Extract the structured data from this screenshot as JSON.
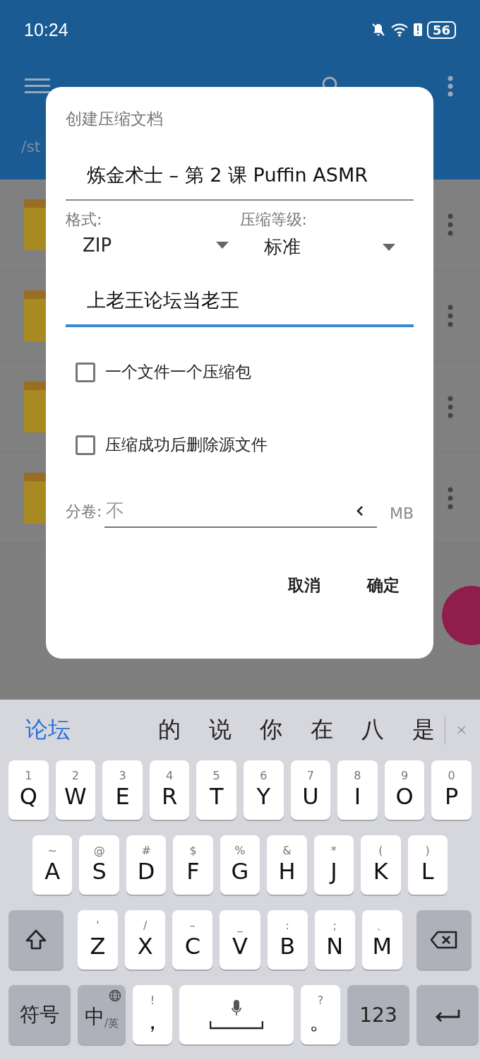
{
  "status_bar": {
    "time": "10:24",
    "battery": "56"
  },
  "path": "/st",
  "file_rows": [
    {
      "kind": "folder"
    },
    {
      "kind": "folder"
    },
    {
      "kind": "folder"
    },
    {
      "kind": "folder"
    }
  ],
  "dialog": {
    "title": "创建压缩文档",
    "name_field": {
      "value": "炼金术士 – 第 2 课 Puffin ASMR",
      "focused": false
    },
    "format": {
      "label": "格式:",
      "value": "ZIP"
    },
    "level": {
      "label": "压缩等级:",
      "value": "标准"
    },
    "password_field": {
      "value": "上老王论坛当老王",
      "focused": true
    },
    "checkboxes": [
      {
        "label": "一个文件一个压缩包",
        "checked": false
      },
      {
        "label": "压缩成功后删除源文件",
        "checked": false
      }
    ],
    "split": {
      "label": "分卷:",
      "placeholder": "不",
      "unit": "MB"
    },
    "buttons": [
      "取消",
      "确定"
    ]
  },
  "keyboard": {
    "candidates": [
      {
        "text": "论坛",
        "selected": true
      },
      {
        "text": "的",
        "selected": false
      },
      {
        "text": "说",
        "selected": false
      },
      {
        "text": "你",
        "selected": false
      },
      {
        "text": "在",
        "selected": false
      },
      {
        "text": "八",
        "selected": false
      },
      {
        "text": "是",
        "selected": false
      }
    ],
    "rows": [
      {
        "keys": [
          {
            "kind": "letter",
            "label": "Q",
            "hint": "1"
          },
          {
            "kind": "letter",
            "label": "W",
            "hint": "2"
          },
          {
            "kind": "letter",
            "label": "E",
            "hint": "3"
          },
          {
            "kind": "letter",
            "label": "R",
            "hint": "4"
          },
          {
            "kind": "letter",
            "label": "T",
            "hint": "5"
          },
          {
            "kind": "letter",
            "label": "Y",
            "hint": "6"
          },
          {
            "kind": "letter",
            "label": "U",
            "hint": "7"
          },
          {
            "kind": "letter",
            "label": "I",
            "hint": "8"
          },
          {
            "kind": "letter",
            "label": "O",
            "hint": "9"
          },
          {
            "kind": "letter",
            "label": "P",
            "hint": "0"
          }
        ]
      },
      {
        "keys": [
          {
            "kind": "letter",
            "label": "A",
            "hint": "~"
          },
          {
            "kind": "letter",
            "label": "S",
            "hint": "@"
          },
          {
            "kind": "letter",
            "label": "D",
            "hint": "#"
          },
          {
            "kind": "letter",
            "label": "F",
            "hint": "$"
          },
          {
            "kind": "letter",
            "label": "G",
            "hint": "%"
          },
          {
            "kind": "letter",
            "label": "H",
            "hint": "&"
          },
          {
            "kind": "letter",
            "label": "J",
            "hint": "*"
          },
          {
            "kind": "letter",
            "label": "K",
            "hint": "("
          },
          {
            "kind": "letter",
            "label": "L",
            "hint": ")"
          }
        ]
      },
      {
        "keys": [
          {
            "kind": "shift"
          },
          {
            "kind": "letter",
            "label": "Z",
            "hint": "'"
          },
          {
            "kind": "letter",
            "label": "X",
            "hint": "/"
          },
          {
            "kind": "letter",
            "label": "C",
            "hint": "–"
          },
          {
            "kind": "letter",
            "label": "V",
            "hint": "_"
          },
          {
            "kind": "letter",
            "label": "B",
            "hint": ":"
          },
          {
            "kind": "letter",
            "label": "N",
            "hint": ";"
          },
          {
            "kind": "letter",
            "label": "M",
            "hint": "、"
          },
          {
            "kind": "backspace"
          }
        ]
      },
      {
        "keys": [
          {
            "kind": "function",
            "label": "符号"
          },
          {
            "kind": "language",
            "label": "中",
            "sub": "/英"
          },
          {
            "kind": "letter",
            "label": "，",
            "hint": "!"
          },
          {
            "kind": "space"
          },
          {
            "kind": "letter",
            "label": "。",
            "hint": "?"
          },
          {
            "kind": "function",
            "label": "123"
          },
          {
            "kind": "enter"
          }
        ]
      }
    ]
  }
}
